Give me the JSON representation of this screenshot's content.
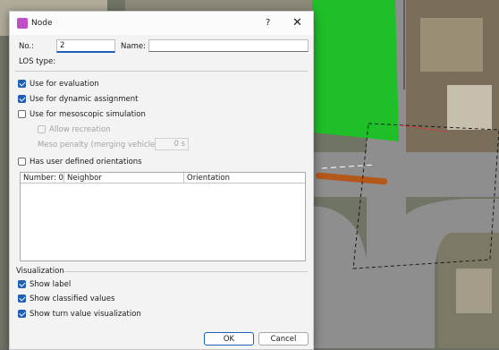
{
  "window": {
    "title": "Node",
    "help_glyph": "?",
    "close_glyph": "✕"
  },
  "fields": {
    "no_label": "No.:",
    "no_value": "2",
    "name_label": "Name:",
    "name_value": "",
    "los_label": "LOS type:"
  },
  "options": {
    "use_evaluation": {
      "label": "Use for evaluation",
      "checked": true
    },
    "use_dynamic": {
      "label": "Use for dynamic assignment",
      "checked": true
    },
    "use_meso": {
      "label": "Use for mesoscopic simulation",
      "checked": false
    },
    "allow_recreation": {
      "label": "Allow recreation",
      "checked": false,
      "disabled": true
    },
    "meso_penalty_label": "Meso penalty (merging vehicles):",
    "meso_penalty_value": "0 s",
    "user_orientations": {
      "label": "Has user defined orientations",
      "checked": false
    }
  },
  "table": {
    "columns": [
      "Number: 0",
      "Neighbor",
      "Orientation"
    ],
    "rows": []
  },
  "visualization": {
    "heading": "Visualization",
    "show_label": {
      "label": "Show label",
      "checked": true
    },
    "show_classified": {
      "label": "Show classified values",
      "checked": true
    },
    "show_turn": {
      "label": "Show turn value visualization",
      "checked": true
    }
  },
  "buttons": {
    "ok": "OK",
    "cancel": "Cancel"
  },
  "colors": {
    "accent": "#1f5fb8",
    "zone_green": "#1fbf2a",
    "road": "#8e8e8e",
    "marker": "#b4571a"
  }
}
